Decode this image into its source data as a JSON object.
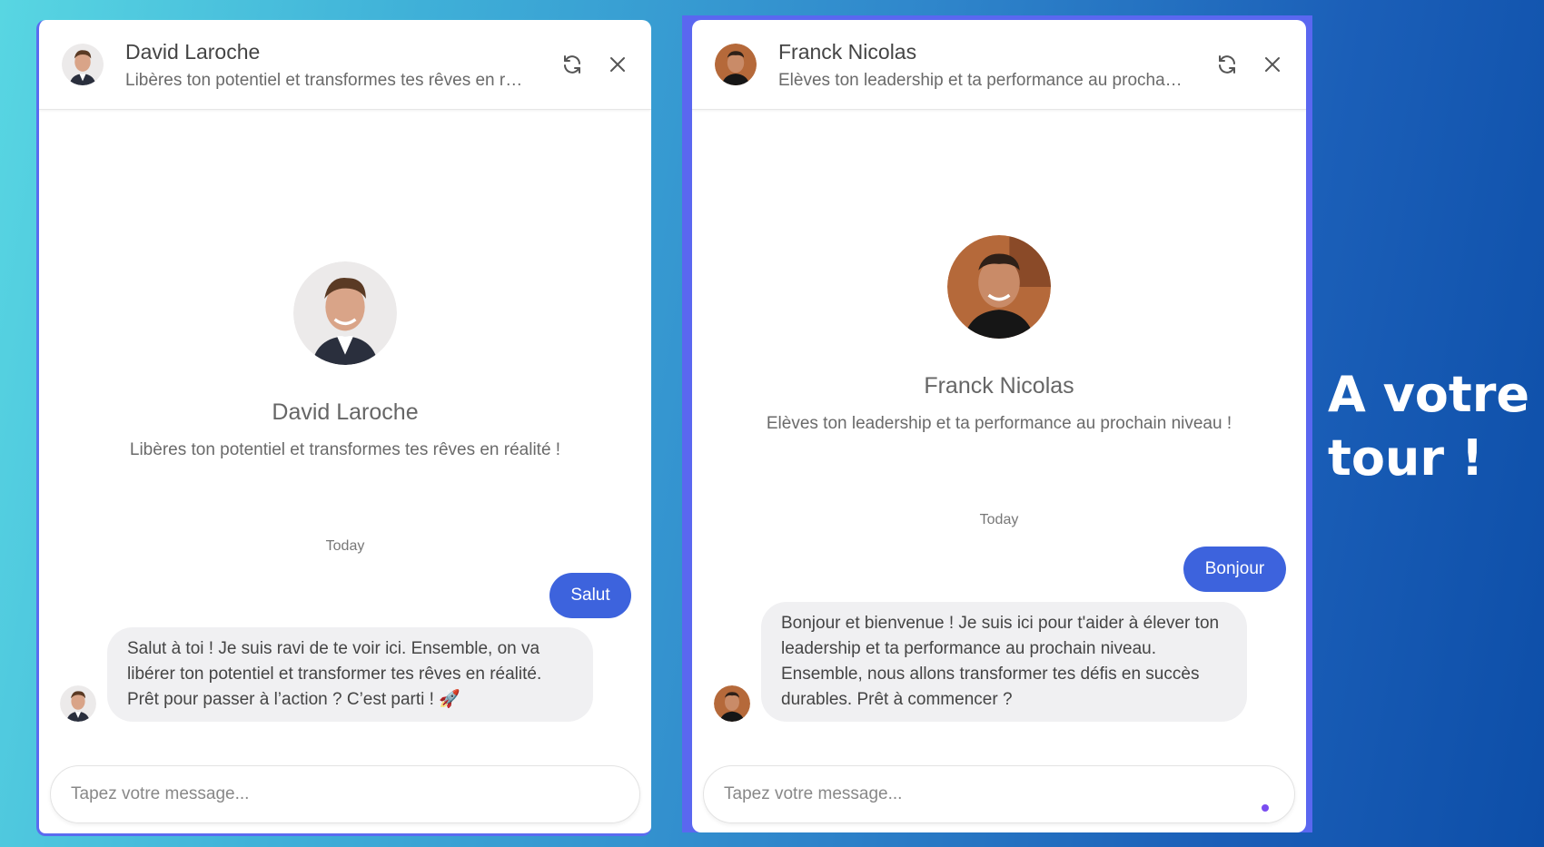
{
  "chats": [
    {
      "header_name": "David Laroche",
      "header_subtitle": "Libères ton potentiel et transformes tes rêves en réalité !",
      "refresh_icon": "refresh-icon",
      "close_icon": "close-icon",
      "profile_name": "David Laroche",
      "profile_subtitle": "Libères ton potentiel et transformes tes rêves en réalité !",
      "date_separator": "Today",
      "user_message": "Salut",
      "bot_message": "Salut à toi ! Je suis ravi de te voir ici. Ensemble, on va libérer ton potentiel et transformer tes rêves en réalité. Prêt pour passer à l’action ? C’est parti ! 🚀",
      "input_placeholder": "Tapez votre message..."
    },
    {
      "header_name": "Franck Nicolas",
      "header_subtitle": "Elèves ton leadership et ta performance au prochain niveau !",
      "refresh_icon": "refresh-icon",
      "close_icon": "close-icon",
      "profile_name": "Franck Nicolas",
      "profile_subtitle": "Elèves ton leadership et ta performance au prochain niveau !",
      "date_separator": "Today",
      "user_message": "Bonjour",
      "bot_message": "Bonjour et bienvenue ! Je suis ici pour t'aider à élever ton leadership et ta performance au prochain niveau. Ensemble, nous allons transformer tes défis en succès durables. Prêt à commencer ?",
      "input_placeholder": "Tapez votre message..."
    }
  ],
  "cta_text": "A votre tour !",
  "colors": {
    "user_bubble": "#3d63dd",
    "bot_bubble": "#f0f0f2",
    "frame_accent": "#5a67f0"
  }
}
